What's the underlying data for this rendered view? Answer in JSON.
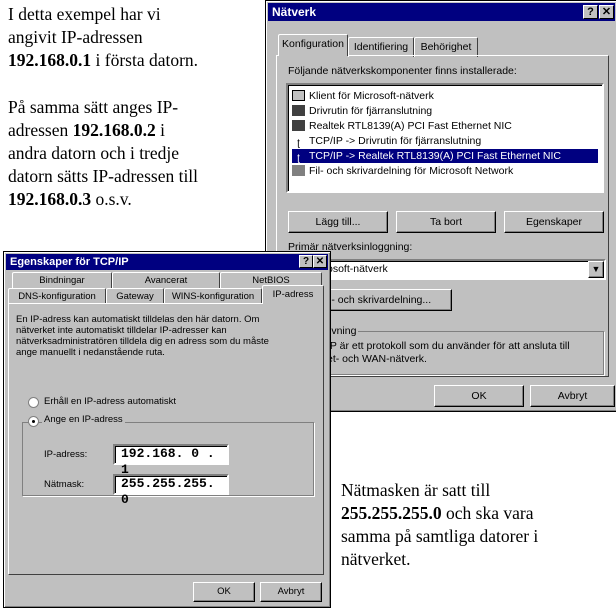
{
  "text_top": {
    "l1": "I detta exempel har vi",
    "l2": "angivit IP-adressen",
    "l3_bold": "192.168.0.1",
    "l3_rest": " i första datorn.",
    "m1": "På samma sätt anges IP-",
    "m2_pre": "adressen ",
    "m2_bold": "192.168.0.2",
    "m2_rest": " i",
    "m3": "andra datorn och i tredje",
    "m4": "datorn sätts IP-adressen till",
    "m5_bold": "192.168.0.3",
    "m5_rest": " o.s.v."
  },
  "text_bottom": {
    "l1": "Nätmasken är satt till",
    "l2_bold": "255.255.255.0",
    "l2_rest": " och ska vara",
    "l3": "samma på samtliga datorer i",
    "l4": "nätverket."
  },
  "natverk": {
    "title": "Nätverk",
    "tabs": [
      "Konfiguration",
      "Identifiering",
      "Behörighet"
    ],
    "installed_label": "Följande nätverkskomponenter finns installerade:",
    "components": [
      {
        "icon": "client-icon",
        "label": "Klient för Microsoft-nätverk"
      },
      {
        "icon": "adapter-icon",
        "label": "Drivrutin för fjärranslutning"
      },
      {
        "icon": "adapter-icon",
        "label": "Realtek RTL8139(A) PCI Fast Ethernet NIC"
      },
      {
        "icon": "protocol-icon",
        "label": "TCP/IP -> Drivrutin för fjärranslutning"
      },
      {
        "icon": "protocol-icon",
        "label": "TCP/IP -> Realtek RTL8139(A) PCI Fast Ethernet NIC"
      },
      {
        "icon": "service-icon",
        "label": "Fil- och skrivardelning för Microsoft Network"
      }
    ],
    "selected_index": 4,
    "add_button": "Lägg till...",
    "remove_button": "Ta bort",
    "properties_button": "Egenskaper",
    "primary_logon_label": "Primär nätverksinloggning:",
    "primary_logon_value": "för Microsoft-nätverk",
    "file_sharing_button": "l- och skrivardelning...",
    "description_legend": "ivning",
    "description_text_1": "IP är ett protokoll som du använder för att ansluta till",
    "description_text_2": "et- och WAN-nätverk.",
    "ok_button": "OK",
    "cancel_button": "Avbryt"
  },
  "tcpip": {
    "title": "Egenskaper för TCP/IP",
    "tabs_back": [
      "Bindningar",
      "Avancerat",
      "NetBIOS"
    ],
    "tabs_front": [
      "DNS-konfiguration",
      "Gateway",
      "WINS-konfiguration",
      "IP-adress"
    ],
    "active_tab": "IP-adress",
    "info_1": "En IP-adress kan automatiskt tilldelas den här datorn. Om",
    "info_2": "nätverket inte automatiskt tilldelar IP-adresser kan",
    "info_3": "nätverksadministratören tilldela dig en adress som du måste",
    "info_4": "ange manuellt i nedanstående ruta.",
    "radio_auto": "Erhåll en IP-adress automatiskt",
    "radio_manual": "Ange en IP-adress",
    "selected_option": "Ange en IP-adress",
    "ip_label": "IP-adress:",
    "ip_value": "192.168. 0 . 1",
    "mask_label": "Nätmask:",
    "mask_value": "255.255.255. 0",
    "ok_button": "OK",
    "cancel_button": "Avbryt"
  }
}
